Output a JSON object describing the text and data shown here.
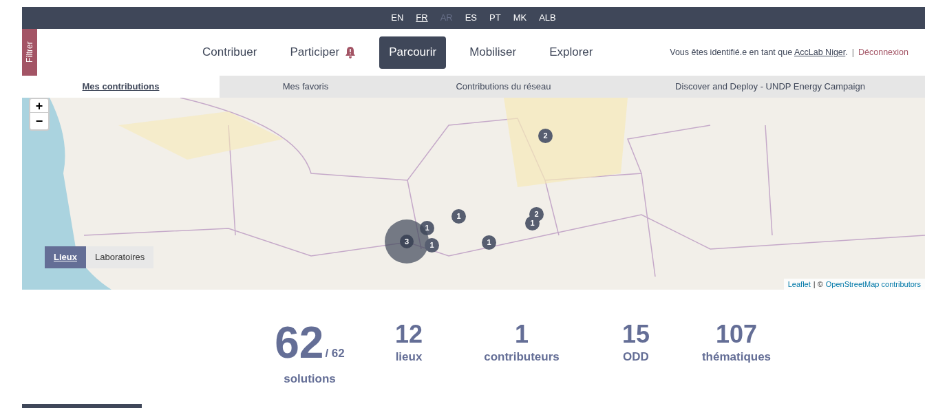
{
  "languages": [
    {
      "label": "EN",
      "selected": false,
      "disabled": false
    },
    {
      "label": "FR",
      "selected": true,
      "disabled": false
    },
    {
      "label": "AR",
      "selected": false,
      "disabled": true
    },
    {
      "label": "ES",
      "selected": false,
      "disabled": false
    },
    {
      "label": "PT",
      "selected": false,
      "disabled": false
    },
    {
      "label": "MK",
      "selected": false,
      "disabled": false
    },
    {
      "label": "ALB",
      "selected": false,
      "disabled": false
    }
  ],
  "filter_tab": {
    "label": "Filtrer"
  },
  "nav": [
    {
      "label": "Contribuer",
      "selected": false,
      "alert": false
    },
    {
      "label": "Participer",
      "selected": false,
      "alert": true
    },
    {
      "label": "Parcourir",
      "selected": true,
      "alert": false
    },
    {
      "label": "Mobiliser",
      "selected": false,
      "alert": false
    },
    {
      "label": "Explorer",
      "selected": false,
      "alert": false
    }
  ],
  "user": {
    "prefix": "Vous êtes identifié.e en tant que",
    "account": "AccLab Niger",
    "suffix": ".",
    "separator": "|",
    "logout": "Déconnexion"
  },
  "tabs": [
    {
      "label": "Mes contributions",
      "selected": true
    },
    {
      "label": "Mes favoris",
      "selected": false
    },
    {
      "label": "Contributions du réseau",
      "selected": false
    },
    {
      "label": "Discover and Deploy - UNDP Energy Campaign",
      "selected": false
    }
  ],
  "map": {
    "zoom_in": "+",
    "zoom_out": "−",
    "layers": [
      {
        "label": "Lieux",
        "selected": true
      },
      {
        "label": "Laboratoires",
        "selected": false
      }
    ],
    "markers": [
      {
        "count": "2",
        "kind": "marker"
      },
      {
        "count": "1",
        "kind": "marker"
      },
      {
        "count": "2",
        "kind": "marker"
      },
      {
        "count": "1",
        "kind": "marker"
      },
      {
        "count": "1",
        "kind": "marker"
      },
      {
        "count": "3",
        "kind": "cluster"
      },
      {
        "count": "1",
        "kind": "marker"
      },
      {
        "count": "1",
        "kind": "marker"
      }
    ],
    "attribution": {
      "library": "Leaflet",
      "separator": "| ©",
      "source": "OpenStreetMap contributors"
    }
  },
  "stats": [
    {
      "value": "62",
      "total": "/ 62",
      "label": "solutions"
    },
    {
      "value": "12",
      "label": "lieux"
    },
    {
      "value": "1",
      "label": "contributeurs"
    },
    {
      "value": "15",
      "label": "ODD"
    },
    {
      "value": "107",
      "label": "thématiques"
    }
  ]
}
